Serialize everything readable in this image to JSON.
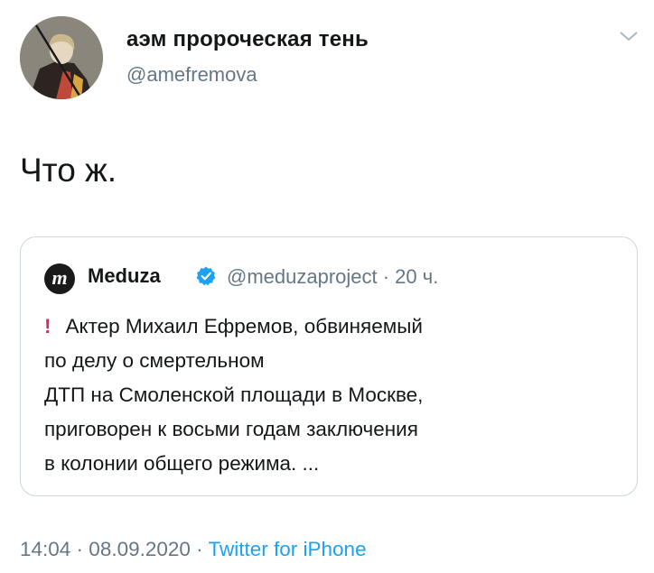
{
  "author": {
    "display_name": "аэм пророческая тень",
    "handle": "@amefremova"
  },
  "tweet": {
    "text": "Что ж."
  },
  "quoted_tweet": {
    "name": "Meduza",
    "logo_letter": "m",
    "handle_time": "@meduzaproject · 20 ч.",
    "excl": "!",
    "lines": [
      "Актер Михаил Ефремов, обвиняемый",
      "по делу о смертельном",
      "ДТП на Смоленской площади в Москве,",
      "приговорен к восьми годам заключения",
      "в колонии общего режима. ..."
    ]
  },
  "footer": {
    "datetime": "14:04 · 08.09.2020 · ",
    "source": "Twitter for iPhone"
  },
  "colors": {
    "link": "#1da1f2",
    "secondary": "#657786",
    "verified": "#1da1f2",
    "alert": "#e0245e"
  }
}
